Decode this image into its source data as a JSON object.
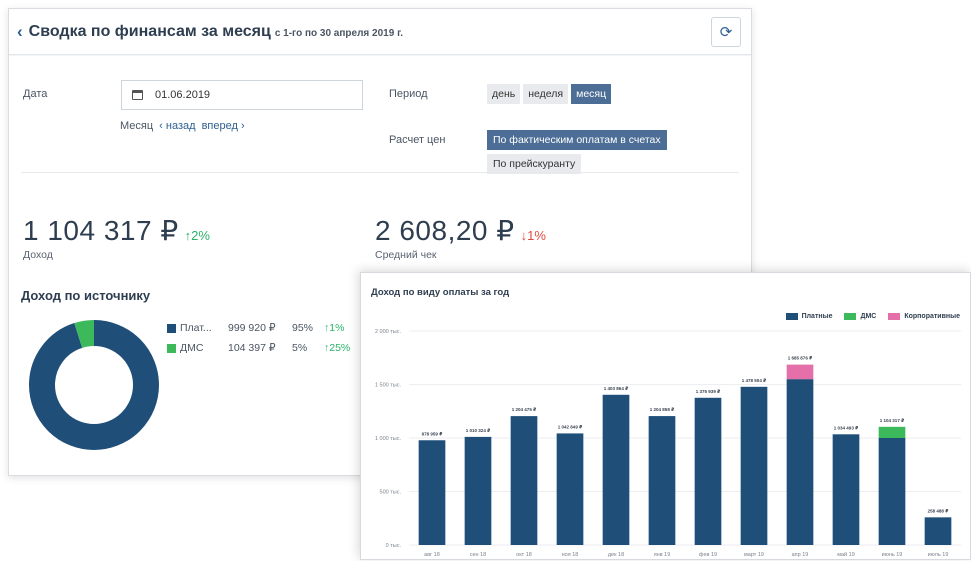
{
  "header": {
    "title": "Сводка по финансам за месяц",
    "period": "с 1-го по 30 апреля 2019 г."
  },
  "filters": {
    "date_label": "Дата",
    "date_value": "01.06.2019",
    "month_label": "Месяц",
    "month_prev": "назад",
    "month_next": "вперед",
    "period_label": "Период",
    "period_options": [
      "день",
      "неделя",
      "месяц"
    ],
    "period_selected": "месяц",
    "pricing_label": "Расчет цен",
    "pricing_options": [
      "По фактическим оплатам в счетах",
      "По прейскуранту"
    ],
    "pricing_selected": "По фактическим оплатам в счетах"
  },
  "kpis": {
    "income": {
      "value": "1 104 317 ₽",
      "delta": "2%",
      "direction": "up",
      "caption": "Доход"
    },
    "avg_check": {
      "value": "2 608,20 ₽",
      "delta": "1%",
      "direction": "down",
      "caption": "Средний чек"
    }
  },
  "income_by_source": {
    "title": "Доход по источнику",
    "rows": [
      {
        "name": "Плат...",
        "amount": "999 920 ₽",
        "share": "95%",
        "change": "1%",
        "color": "#1f4e79",
        "share_value": 95
      },
      {
        "name": "ДМС",
        "amount": "104 397 ₽",
        "share": "5%",
        "change": "25%",
        "color": "#3cb95a",
        "share_value": 5
      }
    ]
  },
  "colors": {
    "paid": "#1f4e79",
    "dms": "#3cb95a",
    "corporate": "#e56fa9",
    "accent": "#4c6e96",
    "up": "#2bb36a",
    "down": "#e2483d"
  },
  "chart_data": {
    "type": "bar",
    "title": "Доход по виду оплаты за год",
    "legend_position": "top-right",
    "ylim": [
      0,
      2000
    ],
    "y_ticks": [
      0,
      500,
      1000,
      1500,
      2000
    ],
    "y_tick_labels": [
      "0 тыс.",
      "500 тыс.",
      "1 000 тыс.",
      "1 500 тыс.",
      "2 000 тыс."
    ],
    "categories": [
      "авг 18",
      "сен 18",
      "окт 18",
      "ноя 18",
      "дек 18",
      "янв 19",
      "фев 19",
      "март 19",
      "апр 19",
      "май 19",
      "июнь 19",
      "июль 19"
    ],
    "series": [
      {
        "name": "Платные",
        "color": "#1f4e79",
        "values": [
          978.9,
          1010.3,
          1204.5,
          1042.8,
          1403.9,
          1204.9,
          1375.9,
          1478.5,
          1550,
          1034.5,
          1000,
          258.5
        ]
      },
      {
        "name": "ДМС",
        "color": "#3cb95a",
        "values": [
          0,
          0,
          0,
          0,
          0,
          0,
          0,
          0,
          0,
          0,
          104.4,
          0
        ]
      },
      {
        "name": "Корпоративные",
        "color": "#e56fa9",
        "values": [
          0,
          0,
          0,
          0,
          0,
          0,
          0,
          0,
          135.9,
          0,
          0,
          0
        ]
      }
    ],
    "bar_labels": [
      "978 959 ₽",
      "1 010 324 ₽",
      "1 204 475 ₽",
      "1 042 849 ₽",
      "1 403 864 ₽",
      "1 204 858 ₽",
      "1 375 939 ₽",
      "1 478 504 ₽",
      "1 685 876 ₽",
      "1 034 493 ₽",
      "1 104 317 ₽",
      "258 488 ₽"
    ],
    "grid": true
  }
}
